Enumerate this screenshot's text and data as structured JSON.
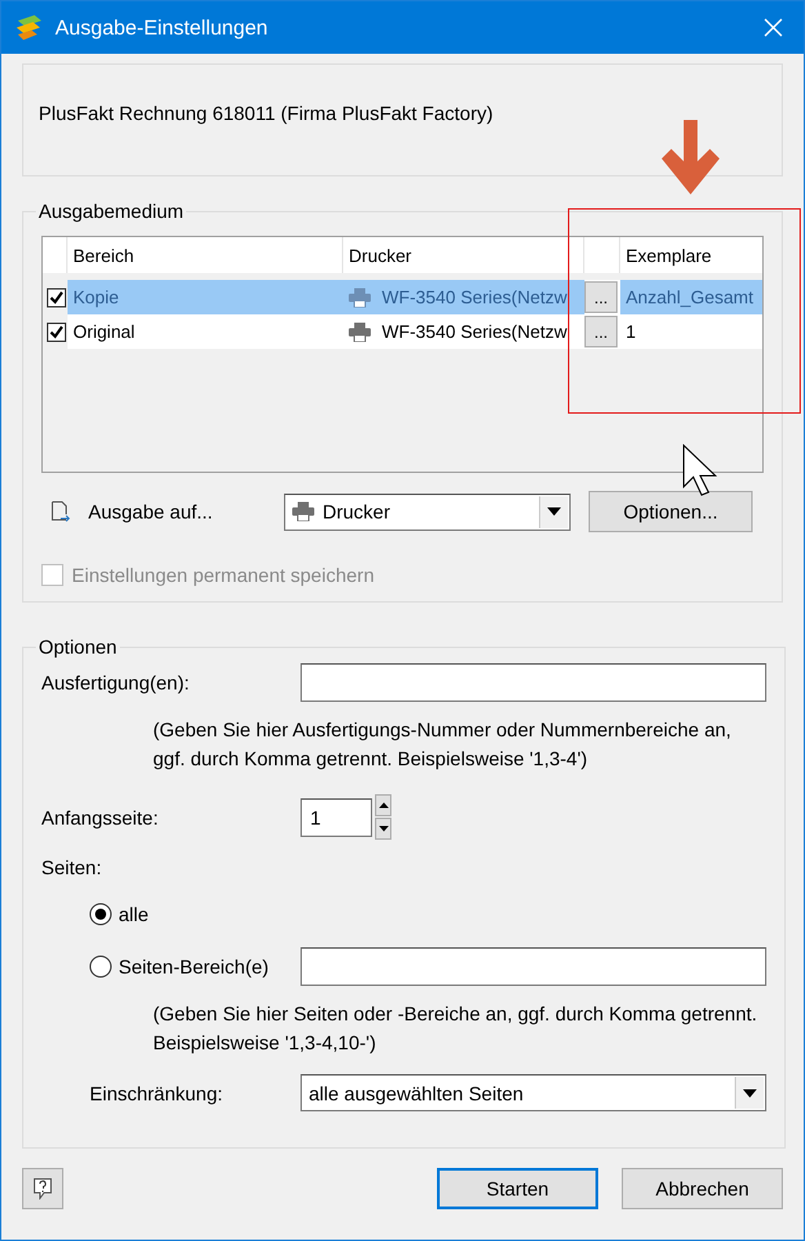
{
  "window": {
    "title": "Ausgabe-Einstellungen"
  },
  "document": "PlusFakt Rechnung 618011 (Firma PlusFakt Factory)",
  "output_medium": {
    "title": "Ausgabemedium",
    "table": {
      "columns": [
        "Bereich",
        "Drucker",
        "Exemplare"
      ],
      "rows": [
        {
          "checked": true,
          "selected": true,
          "area": "Kopie",
          "printer": "WF-3540 Series(Netzw",
          "more": "...",
          "copies": "Anzahl_Gesamt"
        },
        {
          "checked": true,
          "selected": false,
          "area": "Original",
          "printer": "WF-3540 Series(Netzw",
          "more": "...",
          "copies": "1"
        }
      ]
    },
    "output_to": {
      "label": "Ausgabe auf...",
      "value": "Drucker",
      "button": "Optionen..."
    },
    "save_permanent": {
      "label": "Einstellungen permanent speichern",
      "checked": false,
      "disabled": true
    }
  },
  "options": {
    "title": "Optionen",
    "copies": {
      "label": "Ausfertigung(en):"
    },
    "copies_hint": "(Geben Sie hier Ausfertigungs-Nummer oder Nummernbereiche an, ggf. durch Komma getrennt. Beispielsweise '1,3-4')",
    "start_page": {
      "label": "Anfangsseite:",
      "value": "1"
    },
    "pages_label": "Seiten:",
    "pages": [
      {
        "label": "alle",
        "selected": true,
        "kind": "plain"
      },
      {
        "label": "Seiten-Bereich(e)",
        "selected": false,
        "kind": "range"
      }
    ],
    "pages_hint": "(Geben Sie hier Seiten oder -Bereiche an, ggf. durch Komma getrennt. Beispielsweise '1,3-4,10-')",
    "restriction": {
      "label": "Einschränkung:",
      "value": "alle ausgewählten Seiten"
    }
  },
  "buttons": [
    {
      "label": "Starten",
      "default": true
    },
    {
      "label": "Abbrechen",
      "default": false
    }
  ]
}
